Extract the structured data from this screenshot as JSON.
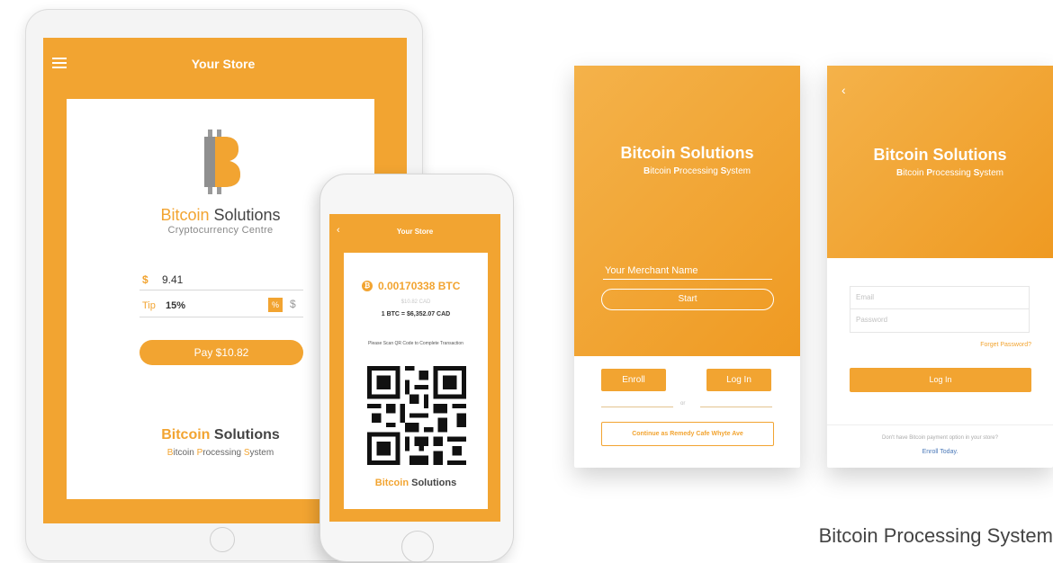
{
  "tablet": {
    "header_title": "Your Store",
    "brand_bitcoin": "Bitcoin",
    "brand_solutions": "Solutions",
    "tagline": "Cryptocurrency Centre",
    "amount_symbol": "$",
    "amount_value": "9.41",
    "tip_label": "Tip",
    "tip_value": "15%",
    "tip_percent_option": "%",
    "tip_dollar_option": "$",
    "pay_button": "Pay $10.82",
    "footer_brand_bitcoin": "Bitcoin",
    "footer_brand_solutions": "Solutions",
    "footer_tagline": {
      "b1": "B",
      "r1": "itcoin ",
      "b2": "P",
      "r2": "rocessing ",
      "b3": "S",
      "r3": "ystem"
    }
  },
  "phone": {
    "back_glyph": "‹",
    "header_title": "Your Store",
    "btc_amount": "0.00170338 BTC",
    "cad_amount": "$10.82 CAD",
    "rate": "1 BTC = $6,352.07 CAD",
    "scan_text": "Please Scan QR Code to Complete Transaction",
    "brand_bitcoin": "Bitcoin",
    "brand_solutions": "Solutions"
  },
  "login_start": {
    "title": "Bitcoin Solutions",
    "subtitle": {
      "b1": "B",
      "r1": "itcoin ",
      "b2": "P",
      "r2": "rocessing ",
      "b3": "S",
      "r3": "ystem"
    },
    "merchant_placeholder": "Your Merchant Name",
    "start_button": "Start",
    "enroll_button": "Enroll",
    "login_button": "Log In",
    "or_text": "or",
    "continue_button": "Continue as Remedy Cafe Whyte Ave"
  },
  "login_form": {
    "back_glyph": "‹",
    "title": "Bitcoin Solutions",
    "subtitle": {
      "b1": "B",
      "r1": "itcoin ",
      "b2": "P",
      "r2": "rocessing ",
      "b3": "S",
      "r3": "ystem"
    },
    "email_placeholder": "Email",
    "password_placeholder": "Password",
    "forget_password": "Forget Password?",
    "login_button": "Log In",
    "no_option_text": "Don't have Bitcoin payment option in your store?",
    "enroll_today": "Enroll Today."
  },
  "caption": "Bitcoin Processing System",
  "colors": {
    "accent": "#f2a431",
    "link": "#4a78b8"
  }
}
